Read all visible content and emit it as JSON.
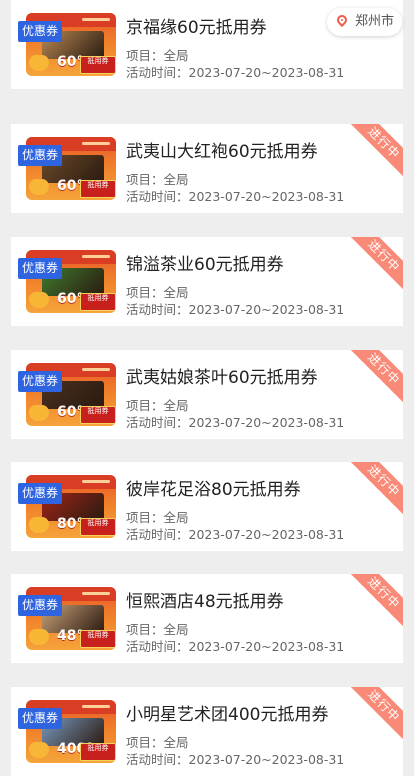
{
  "location": {
    "city": "郑州市"
  },
  "coupons": [
    {
      "title": "京福缘60元抵用券",
      "scope": "项目：全局",
      "period": "活动时间：2023-07-20~2023-08-31",
      "badge": "优惠券",
      "amount": "60°",
      "voucher": "抵用券",
      "status": "",
      "photo_color": "#b98a55"
    },
    {
      "title": "武夷山大红袍60元抵用券",
      "scope": "项目：全局",
      "period": "活动时间：2023-07-20~2023-08-31",
      "badge": "优惠券",
      "amount": "60°",
      "voucher": "抵用券",
      "status": "进行中",
      "photo_color": "#6b4a2a"
    },
    {
      "title": "锦溢茶业60元抵用券",
      "scope": "项目：全局",
      "period": "活动时间：2023-07-20~2023-08-31",
      "badge": "优惠券",
      "amount": "60°",
      "voucher": "抵用券",
      "status": "进行中",
      "photo_color": "#3f7a2e"
    },
    {
      "title": "武夷姑娘茶叶60元抵用券",
      "scope": "项目：全局",
      "period": "活动时间：2023-07-20~2023-08-31",
      "badge": "优惠券",
      "amount": "60°",
      "voucher": "抵用券",
      "status": "进行中",
      "photo_color": "#4a3020"
    },
    {
      "title": "彼岸花足浴80元抵用券",
      "scope": "项目：全局",
      "period": "活动时间：2023-07-20~2023-08-31",
      "badge": "优惠券",
      "amount": "80°",
      "voucher": "抵用券",
      "status": "进行中",
      "photo_color": "#a02418"
    },
    {
      "title": "恒熙酒店48元抵用券",
      "scope": "项目：全局",
      "period": "活动时间：2023-07-20~2023-08-31",
      "badge": "优惠券",
      "amount": "48°",
      "voucher": "抵用券",
      "status": "进行中",
      "photo_color": "#c9a27a"
    },
    {
      "title": "小明星艺术团400元抵用券",
      "scope": "项目：全局",
      "period": "活动时间：2023-07-20~2023-08-31",
      "badge": "优惠券",
      "amount": "400°",
      "voucher": "抵用券",
      "status": "进行中",
      "photo_color": "#7a9ac0"
    }
  ]
}
